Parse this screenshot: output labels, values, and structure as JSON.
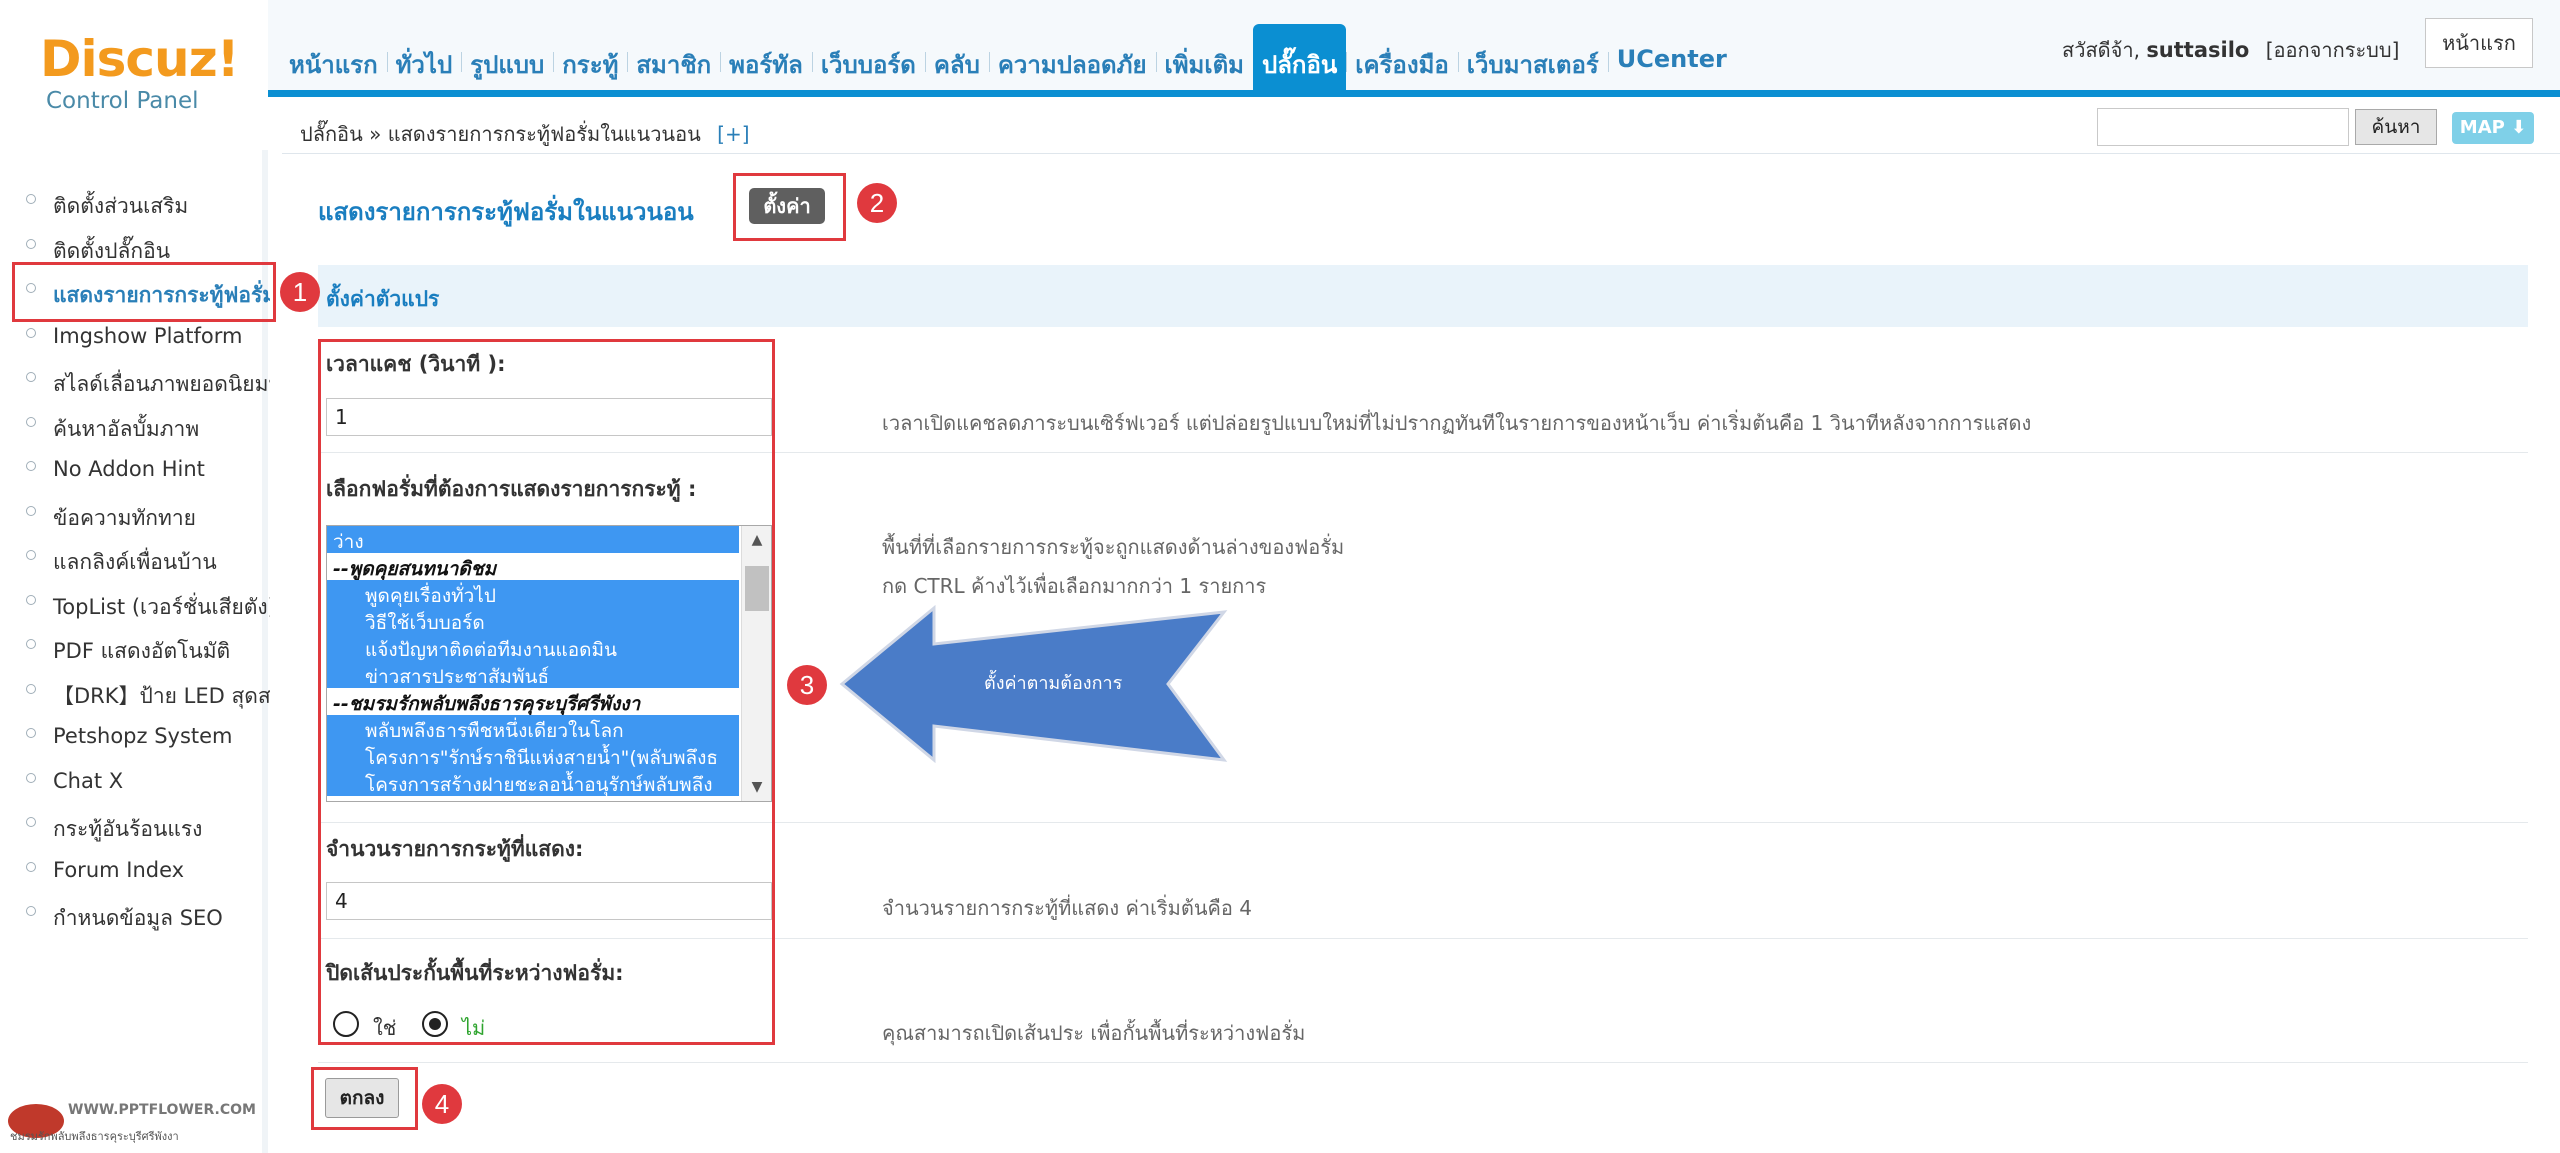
{
  "logo": {
    "brand": "Discuz!",
    "sub": "Control Panel"
  },
  "nav": [
    "หน้าแรก",
    "ทั่วไป",
    "รูปแบบ",
    "กระทู้",
    "สมาชิก",
    "พอร์ทัล",
    "เว็บบอร์ด",
    "คลับ",
    "ความปลอดภัย",
    "เพิ่มเติม",
    "ปลั๊กอิน",
    "เครื่องมือ",
    "เว็บมาสเตอร์",
    "UCenter"
  ],
  "nav_active_index": 10,
  "user": {
    "greeting": "สวัสดีจ้า,",
    "name": "suttasilo",
    "logout": "[ออกจากระบบ]",
    "home_button": "หน้าแรก"
  },
  "breadcrumb": {
    "text": "ปลั๊กอิน » แสดงรายการกระทู้ฟอรั่มในแนวนอน",
    "add": "[+]"
  },
  "search": {
    "button": "ค้นหา",
    "map": "MAP ⬇"
  },
  "sidebar": [
    "ติดตั้งส่วนเสริม",
    "ติดตั้งปลั๊กอิน",
    "แสดงรายการกระทู้ฟอรั่มใ",
    "Imgshow Platform",
    "สไลด์เลื่อนภาพยอดนิยมห",
    "ค้นหาอัลบั้มภาพ",
    "No Addon Hint",
    "ข้อความทักทาย",
    "แลกลิงค์เพื่อนบ้าน",
    "TopList (เวอร์ชั่นเสียตัง)",
    "PDF แสดงอัตโนมัติ",
    "【DRK】ป้าย LED สุดสะ",
    "Petshopz System",
    "Chat X",
    "กระทู้อันร้อนแรง",
    "Forum Index",
    "กำหนดข้อมูล SEO"
  ],
  "sidebar_active_index": 2,
  "bottom_logo": {
    "site": "WWW.PPTFLOWER.COM",
    "caption": "ชมรมรักพลับพลึงธารคุระบุรีศรีพังงา"
  },
  "page": {
    "title": "แสดงรายการกระทู้ฟอรั่มในแนวนอน",
    "settings_button": "ตั้งค่า",
    "section": "ตั้งค่าตัวแปร"
  },
  "form": {
    "cache": {
      "label": "เวลาแคช (วินาที ):",
      "value": "1",
      "desc": "เวลาเปิดแคชลดภาระบนเซิร์ฟเวอร์ แต่ปล่อยรูปแบบใหม่ที่ไม่ปรากฏทันทีในรายการของหน้าเว็บ ค่าเริ่มต้นคือ 1 วินาทีหลังจากการแสดง"
    },
    "forums": {
      "label": "เลือกฟอรั่มที่ต้องการแสดงรายการกระทู้ :",
      "desc1": "พื้นที่ที่เลือกรายการกระทู้จะถูกแสดงด้านล่างของฟอรั่ม",
      "desc2": "กด CTRL ค้างไว้เพื่อเลือกมากกว่า 1 รายการ",
      "options": [
        {
          "text": "ว่าง",
          "type": "sel"
        },
        {
          "text": "--พูดคุยสนทนาดิชม",
          "type": "group"
        },
        {
          "text": "พูดคุยเรื่องทั่วไป",
          "type": "sel child"
        },
        {
          "text": "วิธีใช้เว็บบอร์ด",
          "type": "sel child"
        },
        {
          "text": "แจ้งปัญหาติดต่อทีมงานแอดมิน",
          "type": "sel child"
        },
        {
          "text": "ข่าวสารประชาสัมพันธ์",
          "type": "sel child"
        },
        {
          "text": "--ชมรมรักพลับพลึงธารคุระบุรีศรีพังงา",
          "type": "group"
        },
        {
          "text": "พลับพลึงธารพืชหนึ่งเดียวในโลก",
          "type": "sel child"
        },
        {
          "text": "โครงการ\"รักษ์ราชินีแห่งสายน้ำ\"(พลับพลึงธ",
          "type": "sel child"
        },
        {
          "text": "โครงการสร้างฝายชะลอน้ำอนุรักษ์พลับพลึง",
          "type": "sel child"
        }
      ]
    },
    "count": {
      "label": "จำนวนรายการกระทู้ที่แสดง:",
      "value": "4",
      "desc": "จำนวนรายการกระทู้ที่แสดง ค่าเริ่มต้นคือ 4"
    },
    "divider": {
      "label": "ปิดเส้นประกั้นพื้นที่ระหว่างฟอรั่ม:",
      "yes": "ใช่",
      "no": "ไม่",
      "desc": "คุณสามารถเปิดเส้นประ เพื่อกั้นพื้นที่ระหว่างฟอรั่ม"
    },
    "submit": "ตกลง"
  },
  "annotations": {
    "b1": "1",
    "b2": "2",
    "b3": "3",
    "b4": "4",
    "arrow_text": "ตั้งค่าตามต้องการ"
  },
  "colors": {
    "accent": "#0b8fd2",
    "annotation": "#e0393e",
    "arrow": "#4a7cc8",
    "selected": "#3e97f2"
  }
}
